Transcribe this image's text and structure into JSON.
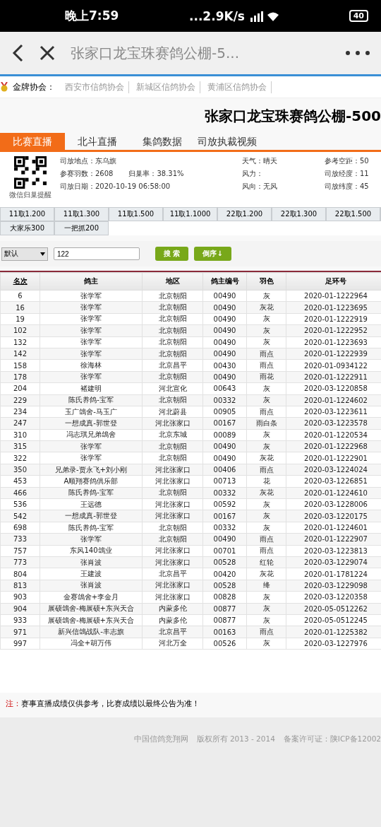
{
  "status_bar": {
    "time": "晚上7:59",
    "speed": "...2.9K/s",
    "battery": "40"
  },
  "browser_bar": {
    "title": "张家口龙宝珠赛鸽公棚-5..."
  },
  "associations": {
    "label": "金牌协会：",
    "items": [
      "西安市信鸽协会",
      "新城区信鸽协会",
      "黄浦区信鸽协会"
    ]
  },
  "page_title": "张家口龙宝珠赛鸽公棚-500",
  "tabs": [
    {
      "label": "比赛直播",
      "selected": true
    },
    {
      "label": "北斗直播",
      "selected": false
    },
    {
      "label": "集鸽数据",
      "selected": false
    },
    {
      "label": "司放执裁视频",
      "selected": false
    }
  ],
  "qr_caption": "微信归巢提醒",
  "info_rows": [
    {
      "left": [
        "司放地点：东乌旗"
      ],
      "mid": "天气：晴天",
      "right": "参考空距：50"
    },
    {
      "left": [
        "参赛羽数：2608",
        "归巢率：38.31%"
      ],
      "mid": "风力：",
      "right": "司放经度：11"
    },
    {
      "left": [
        "司放日期：2020-10-19 06:58:00"
      ],
      "mid": "风向：无风",
      "right": "司放纬度：45"
    }
  ],
  "categories": [
    "11取1.200",
    "11取1.300",
    "11取1.500",
    "11取1.1000",
    "22取1.200",
    "22取1.300",
    "22取1.500",
    "大家乐300",
    "一把抓200"
  ],
  "search": {
    "select": "默认",
    "value": "122",
    "search_button": "搜 索",
    "sort_button": "倒序↓"
  },
  "table": {
    "columns": [
      "名次",
      "鸽主",
      "地区",
      "鸽主编号",
      "羽色",
      "足环号"
    ],
    "rows": [
      [
        "6",
        "张学军",
        "北京朝阳",
        "00490",
        "灰",
        "2020-01-1222964"
      ],
      [
        "16",
        "张学军",
        "北京朝阳",
        "00490",
        "灰花",
        "2020-01-1223695"
      ],
      [
        "19",
        "张学军",
        "北京朝阳",
        "00490",
        "灰",
        "2020-01-1222919"
      ],
      [
        "102",
        "张学军",
        "北京朝阳",
        "00490",
        "灰",
        "2020-01-1222952"
      ],
      [
        "132",
        "张学军",
        "北京朝阳",
        "00490",
        "灰",
        "2020-01-1223693"
      ],
      [
        "142",
        "张学军",
        "北京朝阳",
        "00490",
        "雨点",
        "2020-01-1222939"
      ],
      [
        "158",
        "徐海林",
        "北京昌平",
        "00430",
        "雨点",
        "2020-01-0934122"
      ],
      [
        "178",
        "张学军",
        "北京朝阳",
        "00490",
        "雨花",
        "2020-01-1222911"
      ],
      [
        "204",
        "褚建明",
        "河北宣化",
        "00643",
        "灰",
        "2020-03-1220858"
      ],
      [
        "229",
        "陈氏养鸽-宝军",
        "北京朝阳",
        "00332",
        "灰",
        "2020-01-1224602"
      ],
      [
        "234",
        "玉广鴿舍-马玉广",
        "河北蔚县",
        "00905",
        "雨点",
        "2020-03-1223611"
      ],
      [
        "247",
        "一想成真-郭世登",
        "河北张家口",
        "00167",
        "雨白条",
        "2020-03-1223578"
      ],
      [
        "310",
        "冯志琪兄弟鴿舍",
        "北京东城",
        "00089",
        "灰",
        "2020-01-1220534"
      ],
      [
        "315",
        "张学军",
        "北京朝阳",
        "00490",
        "灰",
        "2020-01-1222968"
      ],
      [
        "322",
        "张学军",
        "北京朝阳",
        "00490",
        "灰花",
        "2020-01-1222901"
      ],
      [
        "350",
        "兄弟录-贾永飞+刘小刚",
        "河北张家口",
        "00406",
        "雨点",
        "2020-03-1224024"
      ],
      [
        "453",
        "A顺翔赛鸽俱乐部",
        "河北张家口",
        "00713",
        "花",
        "2020-03-1226851"
      ],
      [
        "466",
        "陈氏养鸽-宝军",
        "北京朝阳",
        "00332",
        "灰花",
        "2020-01-1224610"
      ],
      [
        "536",
        "王远德",
        "河北张家口",
        "00592",
        "灰",
        "2020-03-1228006"
      ],
      [
        "542",
        "一想成真-郭世登",
        "河北张家口",
        "00167",
        "灰",
        "2020-03-1220175"
      ],
      [
        "698",
        "陈氏养鸽-宝军",
        "北京朝阳",
        "00332",
        "灰",
        "2020-01-1224601"
      ],
      [
        "733",
        "张学军",
        "北京朝阳",
        "00490",
        "雨点",
        "2020-01-1222907"
      ],
      [
        "757",
        "东风140鴿业",
        "河北张家口",
        "00701",
        "雨点",
        "2020-03-1223813"
      ],
      [
        "773",
        "张肖波",
        "河北张家口",
        "00528",
        "红轮",
        "2020-03-1229074"
      ],
      [
        "804",
        "王建波",
        "北京昌平",
        "00420",
        "灰花",
        "2020-01-1781224"
      ],
      [
        "813",
        "张肖波",
        "河北张家口",
        "00528",
        "绛",
        "2020-03-1229098"
      ],
      [
        "903",
        "金赛鴿舍+李金月",
        "河北张家口",
        "00828",
        "灰",
        "2020-03-1220358"
      ],
      [
        "904",
        "展硕鴿舍-梅展硕+东兴天合",
        "内蒙多伦",
        "00877",
        "灰",
        "2020-05-0512262"
      ],
      [
        "933",
        "展硕鴿舍-梅展硕+东兴天合",
        "内蒙多伦",
        "00877",
        "灰",
        "2020-05-0512245"
      ],
      [
        "971",
        "新兴信鴿战队-丰志旗",
        "北京昌平",
        "00163",
        "雨点",
        "2020-01-1225382"
      ],
      [
        "997",
        "冯全+胡万伟",
        "河北万全",
        "00526",
        "灰",
        "2020-03-1227976"
      ]
    ]
  },
  "note": {
    "label": "注：",
    "text": "赛事直播成绩仅供参考，比赛成绩以最终公告为准！"
  },
  "footer": [
    "中国信鸽竞翔网",
    "版权所有 2013 - 2014",
    "备案许可证：陕ICP备12002"
  ]
}
